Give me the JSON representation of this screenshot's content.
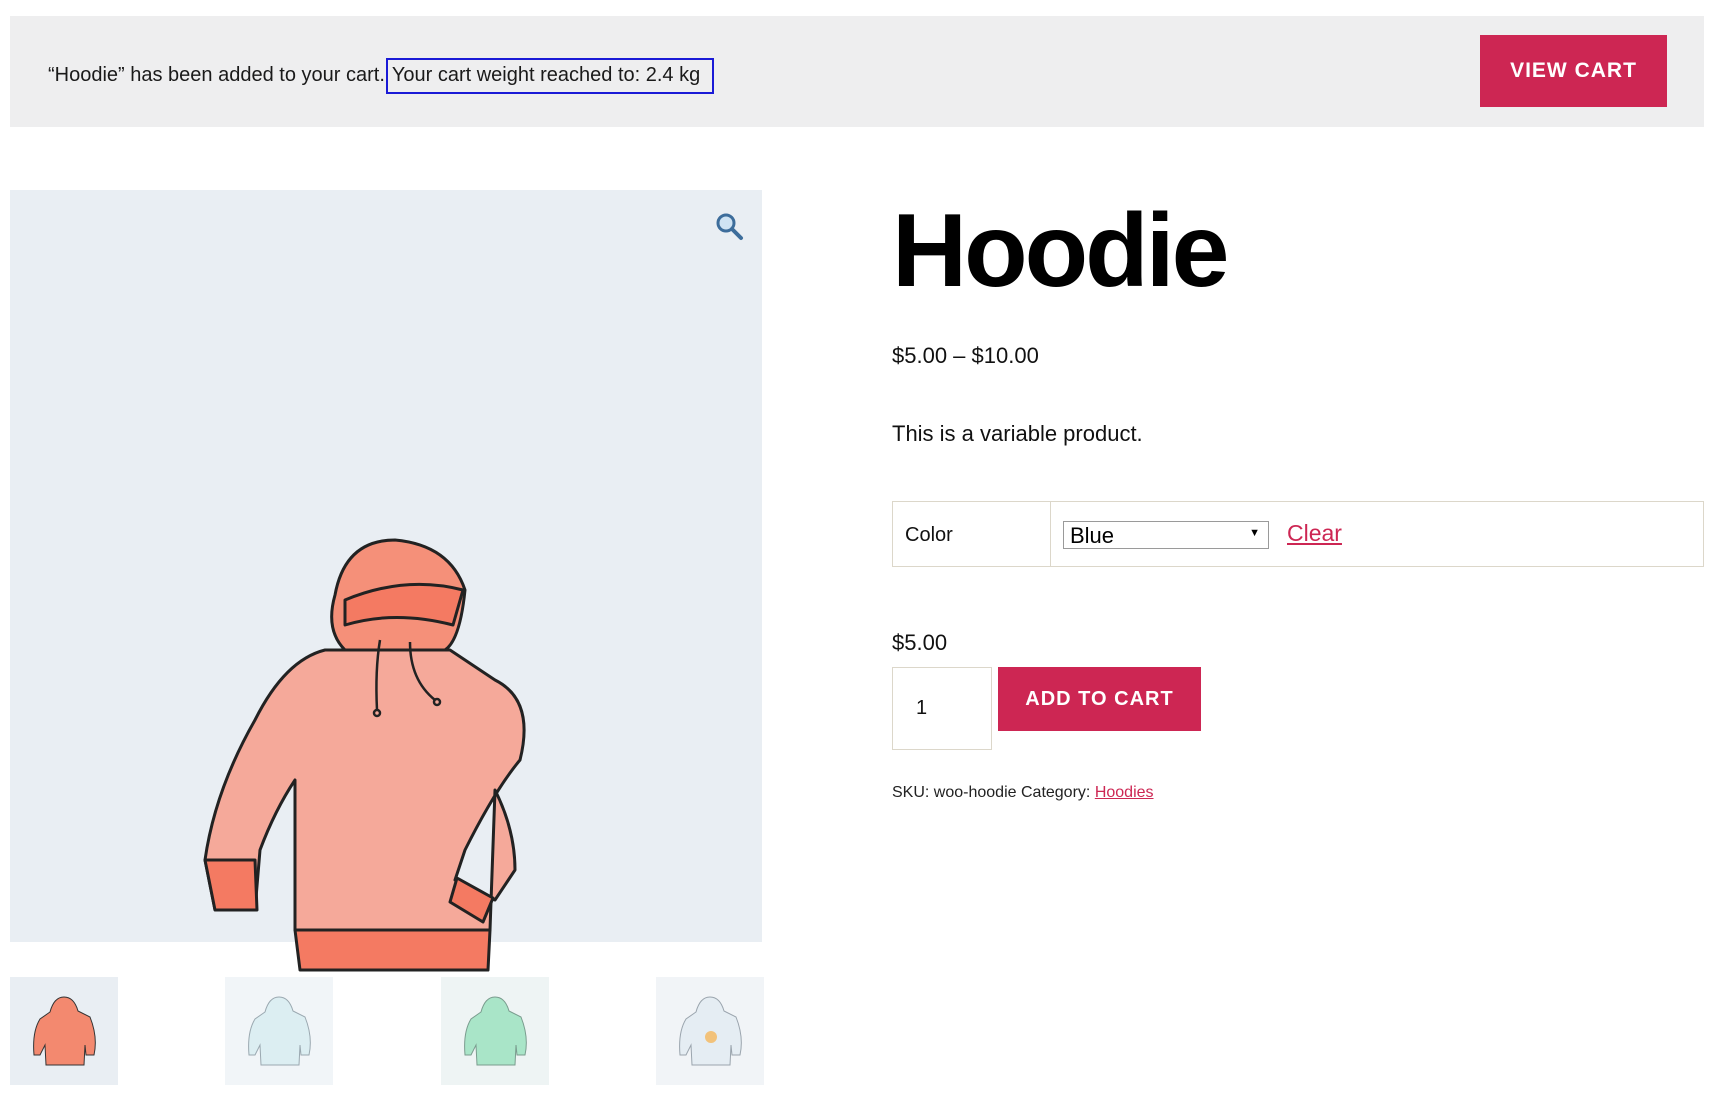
{
  "notice": {
    "message": "“Hoodie” has been added to your cart.",
    "weight_message": "Your cart weight reached to: 2.4 kg",
    "view_cart_label": "VIEW CART"
  },
  "gallery": {
    "zoom_icon": "magnifier-icon",
    "thumbnails": [
      {
        "name": "hoodie-red",
        "color": "#f06f5a",
        "bg": "#e9eef3"
      },
      {
        "name": "hoodie-blue",
        "color": "#d9eaf0",
        "bg": "#f1f5f8"
      },
      {
        "name": "hoodie-green",
        "color": "#9fe0c2",
        "bg": "#eef4f4"
      },
      {
        "name": "hoodie-with-logo",
        "color": "#dfe8f0",
        "bg": "#f1f4f7"
      }
    ]
  },
  "product": {
    "title": "Hoodie",
    "price_range": "$5.00 – $10.00",
    "description": "This is a variable product.",
    "variation": {
      "label": "Color",
      "selected": "Blue",
      "clear_label": "Clear"
    },
    "variation_price": "$5.00",
    "quantity": "1",
    "add_to_cart_label": "ADD TO CART",
    "sku_label": "SKU:",
    "sku": "woo-hoodie",
    "category_label": "Category:",
    "category": "Hoodies"
  },
  "colors": {
    "accent": "#cd2653",
    "notice_bg": "#eeeeef",
    "image_bg": "#e9eef3",
    "highlight_border": "#1a1ad6"
  }
}
